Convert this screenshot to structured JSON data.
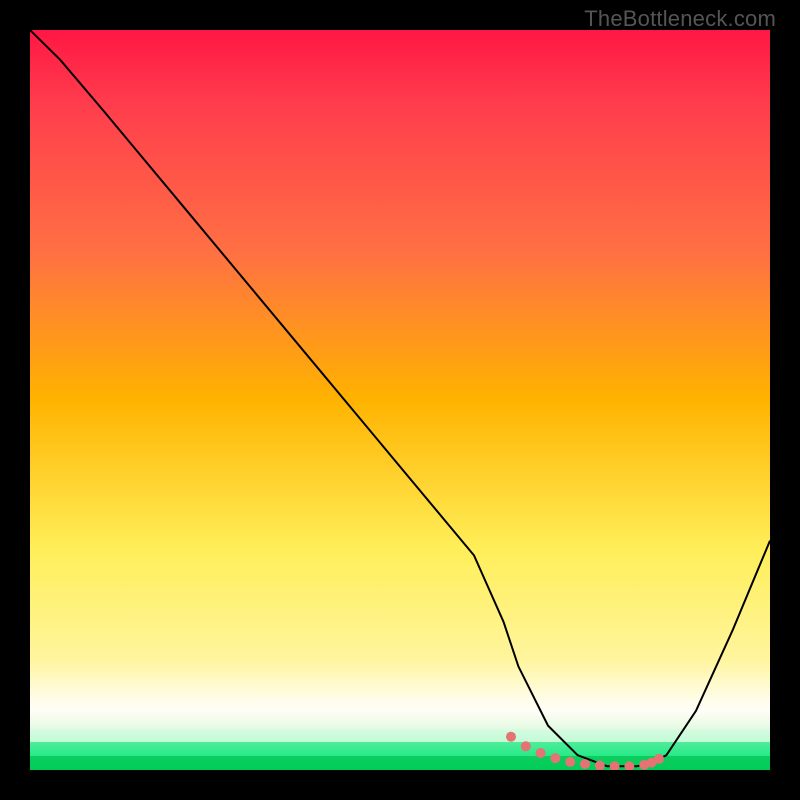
{
  "watermark": "TheBottleneck.com",
  "chart_data": {
    "type": "line",
    "title": "",
    "xlabel": "",
    "ylabel": "",
    "xlim": [
      0,
      100
    ],
    "ylim": [
      0,
      100
    ],
    "background_gradient": {
      "top": "#ff1744",
      "mid1": "#ff9100",
      "mid2": "#ffee58",
      "white": "#ffffff",
      "bottom": "#00e676"
    },
    "series": [
      {
        "name": "bottleneck-curve",
        "x": [
          0,
          4,
          10,
          20,
          30,
          40,
          50,
          60,
          64,
          66,
          70,
          74,
          78,
          82,
          84,
          86,
          90,
          95,
          100
        ],
        "y": [
          100,
          96,
          89,
          77,
          65,
          53,
          41,
          29,
          20,
          14,
          6,
          2,
          0.5,
          0.5,
          1,
          2,
          8,
          19,
          31
        ]
      }
    ],
    "trough_markers": {
      "name": "optimal-range-dots",
      "x": [
        65,
        67,
        69,
        71,
        73,
        75,
        77,
        79,
        81,
        83,
        84,
        85
      ],
      "y": [
        4.5,
        3.2,
        2.3,
        1.6,
        1.1,
        0.8,
        0.6,
        0.5,
        0.5,
        0.7,
        1.0,
        1.5
      ],
      "color": "#e57373",
      "radius": 5
    }
  }
}
